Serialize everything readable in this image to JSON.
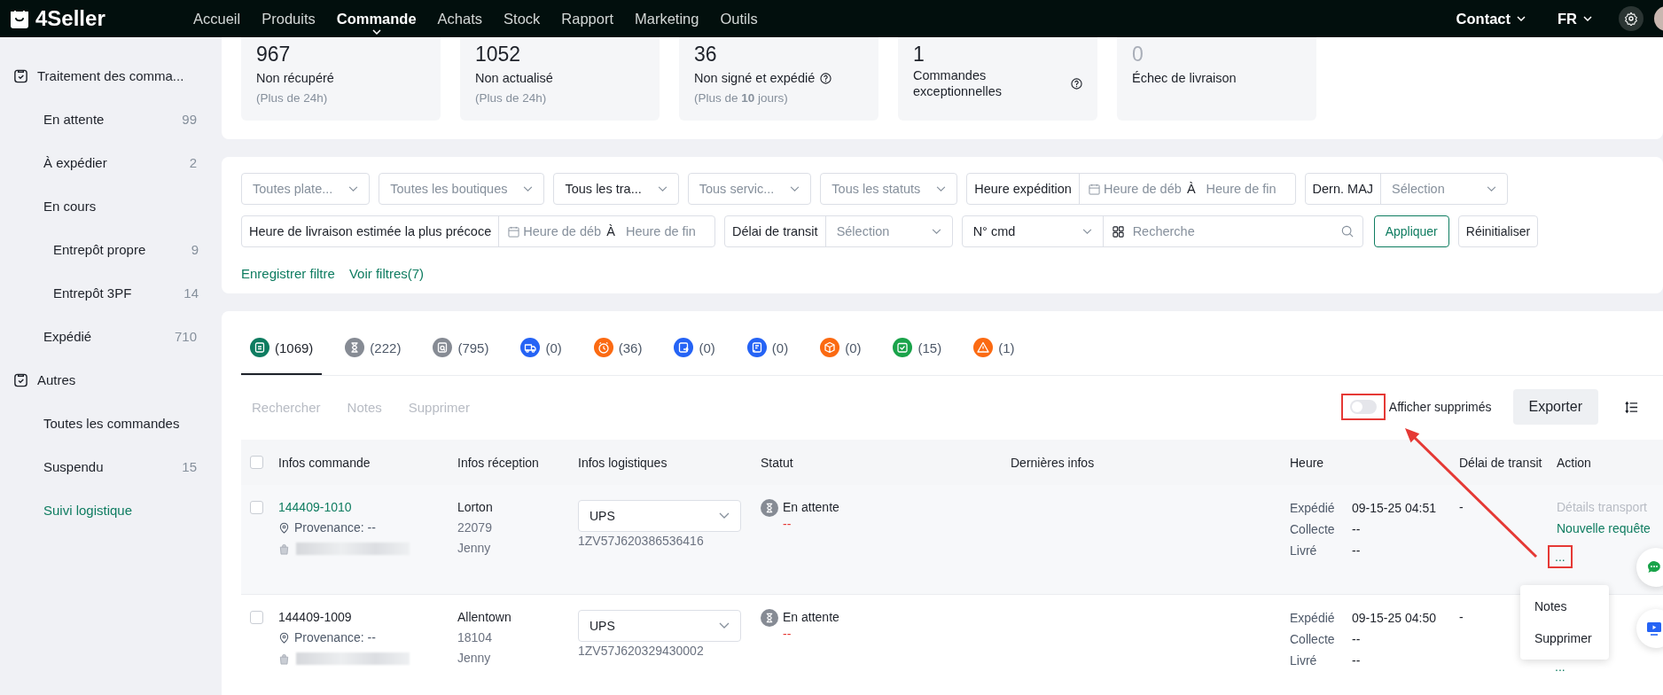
{
  "header": {
    "logo": "4Seller",
    "nav": [
      {
        "label": "Accueil",
        "selected": false
      },
      {
        "label": "Produits",
        "selected": false
      },
      {
        "label": "Commande",
        "selected": true
      },
      {
        "label": "Achats",
        "selected": false
      },
      {
        "label": "Stock",
        "selected": false
      },
      {
        "label": "Rapport",
        "selected": false
      },
      {
        "label": "Marketing",
        "selected": false
      },
      {
        "label": "Outils",
        "selected": false
      }
    ],
    "contact": "Contact",
    "language": "FR"
  },
  "sidebar": [
    {
      "title": "Traitement des comma...",
      "items": [
        {
          "label": "En attente",
          "count": "99",
          "selected": false
        },
        {
          "label": "À expédier",
          "count": "2",
          "selected": false
        },
        {
          "label": "En cours",
          "selected": false,
          "children": [
            {
              "label": "Entrepôt propre",
              "count": "9",
              "selected": false
            },
            {
              "label": "Entrepôt 3PF",
              "count": "14",
              "selected": false
            }
          ]
        },
        {
          "label": "Expédié",
          "count": "710",
          "selected": false
        }
      ]
    },
    {
      "title": "Autres",
      "items": [
        {
          "label": "Toutes les commandes",
          "selected": false
        },
        {
          "label": "Suspendu",
          "count": "15",
          "selected": false
        },
        {
          "label": "Suivi logistique",
          "selected": true
        }
      ]
    }
  ],
  "stats": [
    {
      "value": "967",
      "label": "Non récupéré",
      "note": "(Plus de 24h)",
      "help": false,
      "muted": false
    },
    {
      "value": "1052",
      "label": "Non actualisé",
      "note": "(Plus de 24h)",
      "help": false,
      "muted": false
    },
    {
      "value": "36",
      "label": "Non signé et expédié",
      "note": "(Plus de **10** jours)",
      "help": true,
      "muted": false
    },
    {
      "value": "1",
      "label": "Commandes exceptionnelles",
      "help": true,
      "muted": false
    },
    {
      "value": "0",
      "label": "Échec de livraison",
      "help": false,
      "muted": true
    }
  ],
  "filters": {
    "first_row": [
      {
        "kind": "select",
        "placeholder": "Toutes plate..."
      },
      {
        "kind": "select",
        "placeholder": "Toutes les boutiques"
      },
      {
        "kind": "select",
        "value": "Tous les tra..."
      },
      {
        "kind": "select",
        "placeholder": "Tous servic..."
      },
      {
        "kind": "select",
        "placeholder": "Tous les statuts"
      },
      {
        "kind": "date_range",
        "label": "Heure expédition",
        "start_placeholder": "Heure de déb",
        "separator": "À",
        "end_placeholder": "Heure de fin"
      },
      {
        "kind": "labeled_select",
        "label": "Dern. MAJ",
        "placeholder": "Sélection"
      }
    ],
    "second_row": [
      {
        "kind": "date_range",
        "label": "Heure de livraison estimée la plus précoce",
        "start_placeholder": "Heure de déb",
        "separator": "À",
        "end_placeholder": "Heure de fin"
      },
      {
        "kind": "labeled_select",
        "label": "Délai de transit",
        "placeholder": "Sélection"
      },
      {
        "kind": "select_search",
        "value": "N° cmd",
        "placeholder": "Recherche"
      }
    ],
    "apply": "Appliquer",
    "reset": "Réinitialiser",
    "links": [
      "Enregistrer filtre",
      "Voir filtres(7)"
    ]
  },
  "tabs": [
    {
      "kind": "list",
      "count": "(1069)",
      "color": "#0e7c60",
      "selected": true
    },
    {
      "kind": "hourglass",
      "count": "(222)",
      "color": "#868b94",
      "selected": false
    },
    {
      "kind": "doc_search",
      "count": "(795)",
      "color": "#868b94",
      "selected": false
    },
    {
      "kind": "truck",
      "count": "(0)",
      "color": "#2563f5",
      "selected": false
    },
    {
      "kind": "clock",
      "count": "(36)",
      "color": "#fb6a12",
      "selected": false
    },
    {
      "kind": "export",
      "count": "(0)",
      "color": "#2563f5",
      "selected": false
    },
    {
      "kind": "doc",
      "count": "(0)",
      "color": "#2563f5",
      "selected": false
    },
    {
      "kind": "box",
      "count": "(0)",
      "color": "#fb6a12",
      "selected": false
    },
    {
      "kind": "check",
      "count": "(15)",
      "color": "#1aa34a",
      "selected": false
    },
    {
      "kind": "warning",
      "count": "(1)",
      "color": "#fb6a12",
      "selected": false
    }
  ],
  "toolbar": {
    "actions": [
      {
        "label": "Rechercher",
        "disabled": true
      },
      {
        "label": "Notes",
        "disabled": true
      },
      {
        "label": "Supprimer",
        "disabled": true
      }
    ],
    "toggle": {
      "label": "Afficher supprimés",
      "on": false,
      "highlighted": true
    },
    "export": "Exporter"
  },
  "table": {
    "all_checked": false,
    "columns": [
      "Infos commande",
      "Infos réception",
      "Infos logistiques",
      "Statut",
      "Dernières infos",
      "Heure",
      "Délai de transit",
      "Action"
    ],
    "rows": [
      {
        "hovered": true,
        "checked": false,
        "order": "144409-1010",
        "origin": "Provenance: --",
        "city": "Lorton",
        "zip": "22079",
        "name": "Jenny",
        "carrier": "UPS",
        "tracking": "1ZV57J620386536416",
        "status": "En attente",
        "status_note": "--",
        "times": [
          {
            "label": "Expédié",
            "value": "09-15-25 04:51"
          },
          {
            "label": "Collecte",
            "value": "--"
          },
          {
            "label": "Livré",
            "value": "--"
          }
        ],
        "transit": "-",
        "actions": [
          {
            "label": "Détails transport",
            "disabled": true
          },
          {
            "label": "Nouvelle requête",
            "disabled": false
          }
        ],
        "more": "...",
        "more_highlighted": true
      },
      {
        "hovered": false,
        "checked": false,
        "order": "144409-1009",
        "origin": "Provenance: --",
        "city": "Allentown",
        "zip": "18104",
        "name": "Jenny",
        "carrier": "UPS",
        "tracking": "1ZV57J620329430002",
        "status": "En attente",
        "status_note": "--",
        "times": [
          {
            "label": "Expédié",
            "value": "09-15-25 04:50"
          },
          {
            "label": "Collecte",
            "value": "--"
          },
          {
            "label": "Livré",
            "value": "--"
          }
        ],
        "transit": "-",
        "more": "...",
        "more_highlighted": false
      }
    ]
  },
  "more_menu": [
    "Notes",
    "Supprimer"
  ]
}
